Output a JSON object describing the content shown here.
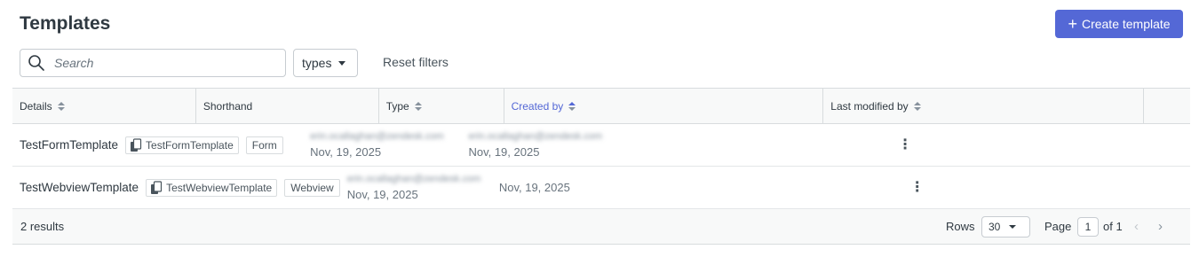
{
  "header": {
    "title": "Templates",
    "create_button": "Create template",
    "create_icon": "plus-icon"
  },
  "filters": {
    "search_placeholder": "Search",
    "types_label": "types",
    "reset_label": "Reset filters"
  },
  "table": {
    "columns": [
      "Details",
      "Shorthand",
      "Type",
      "Created by",
      "Last modified by"
    ],
    "sorted_column": "Created by",
    "rows": [
      {
        "details": "TestFormTemplate",
        "shorthand": "TestFormTemplate",
        "type": "Form",
        "created_by": "erin.ocallaghan@zendesk.com",
        "created_date": "Nov, 19, 2025",
        "modified_by": "erin.ocallaghan@zendesk.com",
        "modified_date": "Nov, 19, 2025"
      },
      {
        "details": "TestWebviewTemplate",
        "shorthand": "TestWebviewTemplate",
        "type": "Webview",
        "created_by": "erin.ocallaghan@zendesk.com",
        "created_date": "Nov, 19, 2025",
        "modified_by": "",
        "modified_date": "Nov, 19, 2025"
      }
    ]
  },
  "footer": {
    "results": "2 results",
    "rows_label": "Rows",
    "rows_value": "30",
    "page_label": "Page",
    "page_value": "1",
    "of_label": "of 1"
  },
  "colors": {
    "accent": "#5468d6",
    "header_bg": "#f8f9f9",
    "border": "#d8dcde"
  }
}
